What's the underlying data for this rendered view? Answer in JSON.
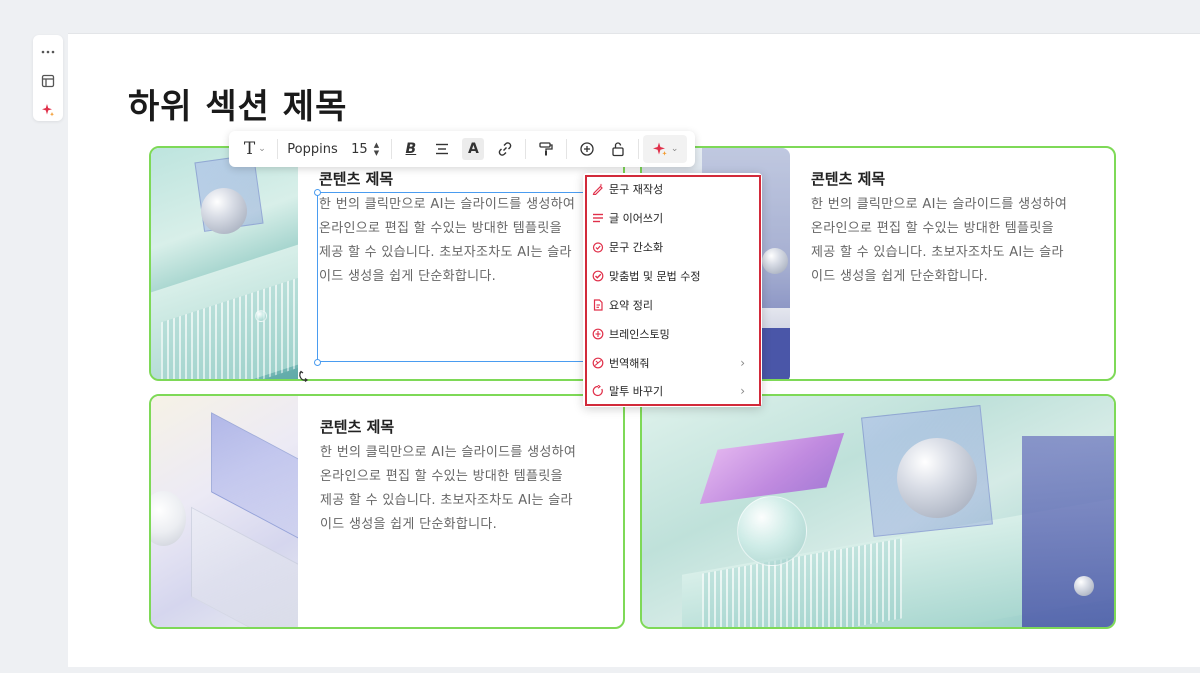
{
  "slide": {
    "title": "하위 섹션 제목"
  },
  "cards": [
    {
      "title": "콘텐츠 제목",
      "body_lines": [
        "한 번의 클릭만으로 AI는 슬라이드를 생성하여",
        "온라인으로 편집 할 수있는 방대한 템플릿을",
        "제공 할 수 있습니다. 초보자조차도 AI는 슬라",
        "이드 생성을 쉽게 단순화합니다."
      ]
    },
    {
      "title": "콘텐츠 제목",
      "body_lines": [
        "한 번의 클릭만으로 AI는 슬라이드를 생성하여",
        "온라인으로 편집 할 수있는 방대한 템플릿을",
        "제공 할 수 있습니다. 초보자조차도 AI는 슬라",
        "이드 생성을 쉽게 단순화합니다."
      ]
    },
    {
      "title": "콘텐츠 제목",
      "body_lines": [
        "한 번의 클릭만으로 AI는 슬라이드를 생성하여",
        "온라인으로 편집 할 수있는 방대한 템플릿을",
        "제공 할 수 있습니다. 초보자조차도 AI는 슬라",
        "이드 생성을 쉽게 단순화합니다."
      ]
    }
  ],
  "toolbar": {
    "font_name": "Poppins",
    "font_size": "15"
  },
  "ai_menu": {
    "items": [
      {
        "label": "문구 재작성",
        "icon": "pen-sparkle-icon",
        "has_submenu": false
      },
      {
        "label": "글 이어쓰기",
        "icon": "lines-icon",
        "has_submenu": false
      },
      {
        "label": "문구 간소화",
        "icon": "simplify-icon",
        "has_submenu": false
      },
      {
        "label": "맞춤법 및 문법 수정",
        "icon": "spellcheck-icon",
        "has_submenu": false
      },
      {
        "label": "요약 정리",
        "icon": "summary-icon",
        "has_submenu": false
      },
      {
        "label": "브레인스토밍",
        "icon": "brainstorm-icon",
        "has_submenu": false
      },
      {
        "label": "번역해줘",
        "icon": "translate-icon",
        "has_submenu": true
      },
      {
        "label": "말투 바꾸기",
        "icon": "tone-icon",
        "has_submenu": true
      }
    ]
  },
  "colors": {
    "card_border": "#7ed957",
    "menu_highlight": "#d22a3a",
    "icon_accent": "#e0304a",
    "selection": "#4a9cf0"
  }
}
